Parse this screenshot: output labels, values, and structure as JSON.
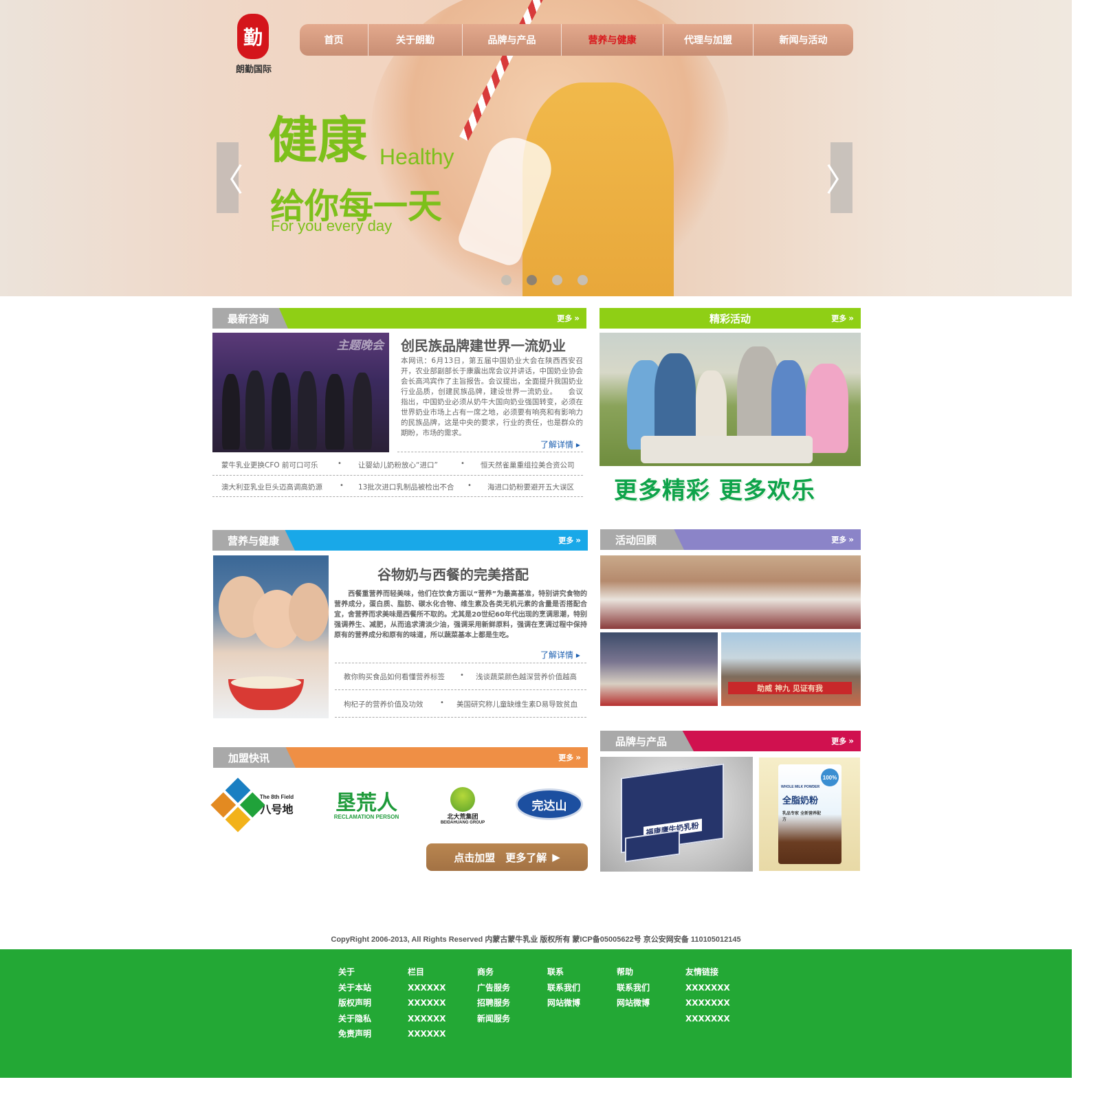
{
  "brand": {
    "seal": "勤",
    "name": "朗勤国际"
  },
  "nav": {
    "items": [
      "首页",
      "关于朗勤",
      "品牌与产品",
      "营养与健康",
      "代理与加盟",
      "新闻与活动"
    ],
    "active": "营养与健康"
  },
  "hero": {
    "title_cn": "健康",
    "title_en": "Healthy",
    "subtitle_cn": "给你每一天",
    "subtitle_en": "For you every day",
    "prev": "〈",
    "next": "〉",
    "slide_count": 4,
    "active_slide": 2
  },
  "more_label": "更多",
  "latest_news": {
    "header": "最新咨询",
    "image_label": "主题晚会",
    "title": "创民族品牌建世界一流奶业",
    "body": "本网讯：6月13日，第五届中国奶业大会在陕西西安召开，农业部副部长于康震出席会议并讲话，中国奶业协会会长高鸿宾作了主旨报告。会议提出，全面提升我国奶业行业品质，创建民族品牌，建设世界一流奶业。　　会议指出，中国奶业必须从奶牛大国向奶业强国转变，必须在世界奶业市场上占有一席之地，必须要有响亮和有影响力的民族品牌，这是中央的要求，行业的责任，也是群众的期盼，市场的需求。",
    "more": "了解详情",
    "items": [
      [
        "蒙牛乳业更换CFO 前可口可乐",
        "让婴幼儿奶粉放心“进口”",
        "恒天然雀巢重组拉美合资公司"
      ],
      [
        "澳大利亚乳业巨头迈高调高奶源",
        "13批次进口乳制品被检出不合",
        "海进口奶粉要避开五大误区"
      ]
    ]
  },
  "activities": {
    "header": "精彩活动",
    "promo": "更多精彩  更多欢乐"
  },
  "nutrition": {
    "header": "营养与健康",
    "title": "谷物奶与西餐的完美搭配",
    "body": "　　西餐重营养而轻美味，他们在饮食方面以“营养”为最高基准，特别讲究食物的营养成分，蛋白质、脂肪、碳水化合物、维生素及各类无机元素的含量是否搭配合宜，舍营养而求美味是西餐所不取的。尤其是20世纪60年代出现的烹调思潮，特别强调养生、减肥，从而追求清淡少油，强调采用新鲜原料，强调在烹调过程中保持原有的营养成分和原有的味道，所以蔬菜基本上都是生吃。",
    "more": "了解详情",
    "items": [
      [
        "教你购买食品如何看懂营养标签",
        "浅谈蔬菜颜色越深营养价值越高"
      ],
      [
        "枸杞子的营养价值及功效",
        "美国研究称儿童缺维生素D易导致贫血"
      ]
    ]
  },
  "review": {
    "header": "活动回顾",
    "banner_text": "助威 神九 见证有我"
  },
  "franchise": {
    "header": "加盟快讯",
    "brands": [
      {
        "en": "The 8th Field",
        "cn": "八号地"
      },
      {
        "cn": "垦荒人",
        "en": "RECLAMATION PERSON"
      },
      {
        "cn": "北大荒集团",
        "en": "BEIDAHUANG GROUP"
      },
      {
        "cn": "完达山"
      }
    ],
    "button": "点击加盟　更多了解",
    "button_icon": "▶"
  },
  "products": {
    "header": "品牌与产品",
    "box_text": "福康鹰牛奶乳粉",
    "bag_title": "全脂奶粉",
    "bag_en": "WHOLE MILK POWDER",
    "bag_badge": "100%",
    "bag_sub": "乳品专家 全新营养配方"
  },
  "copyright": "CopyRight 2006-2013, All Rights Reserved 内蒙古蒙牛乳业 版权所有 蒙ICP备05005622号 京公安网安备 110105012145",
  "footer": {
    "columns": [
      [
        "关于",
        "关于本站",
        "版权声明",
        "关于隐私",
        "免责声明"
      ],
      [
        "栏目",
        "XXXXXX",
        "XXXXXX",
        "XXXXXX",
        "XXXXXX"
      ],
      [
        "商务",
        "广告服务",
        "招聘服务",
        "新闻服务"
      ],
      [
        "联系",
        "联系我们",
        "网站微博"
      ],
      [
        "帮助",
        "联系我们",
        "网站微博"
      ],
      [
        "友情链接",
        "XXXXXXX",
        "XXXXXXX",
        "XXXXXXX"
      ]
    ]
  },
  "colors": {
    "green": "#23a835",
    "accent_green": "#8fcf15",
    "blue": "#19a8e8",
    "purple": "#8b84c8",
    "orange": "#ef8f45",
    "crimson": "#d0114f",
    "nav_active": "#d8161b"
  }
}
